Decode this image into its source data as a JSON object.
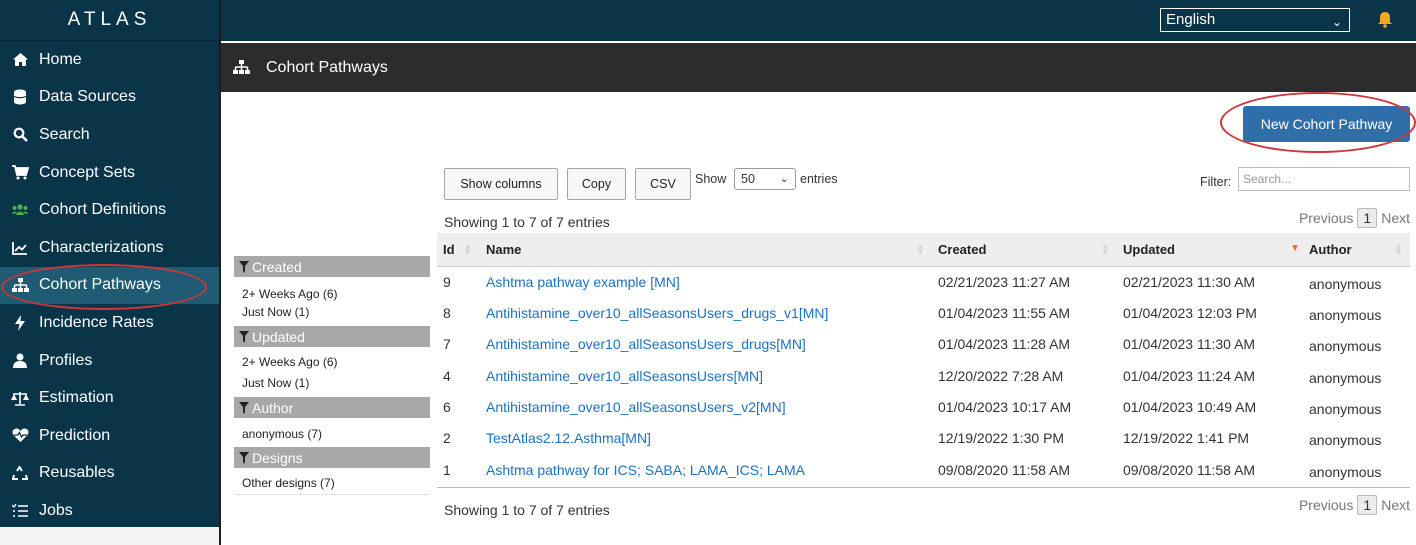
{
  "app": {
    "brand": "ATLAS",
    "language": "English"
  },
  "sidebar": {
    "items": [
      {
        "label": "Home",
        "icon": "home-icon"
      },
      {
        "label": "Data Sources",
        "icon": "database-icon"
      },
      {
        "label": "Search",
        "icon": "search-icon"
      },
      {
        "label": "Concept Sets",
        "icon": "cart-icon"
      },
      {
        "label": "Cohort Definitions",
        "icon": "users-icon"
      },
      {
        "label": "Characterizations",
        "icon": "chart-line-icon"
      },
      {
        "label": "Cohort Pathways",
        "icon": "sitemap-icon",
        "active": true
      },
      {
        "label": "Incidence Rates",
        "icon": "bolt-icon"
      },
      {
        "label": "Profiles",
        "icon": "user-icon"
      },
      {
        "label": "Estimation",
        "icon": "balance-scale-icon"
      },
      {
        "label": "Prediction",
        "icon": "heartbeat-icon"
      },
      {
        "label": "Reusables",
        "icon": "recycle-icon"
      },
      {
        "label": "Jobs",
        "icon": "list-icon"
      }
    ]
  },
  "page": {
    "title": "Cohort Pathways",
    "new_button": "New Cohort Pathway"
  },
  "toolbar": {
    "show_columns": "Show columns",
    "copy": "Copy",
    "csv": "CSV",
    "show_label": "Show",
    "entries_label": "entries",
    "page_length": "50",
    "filter_label": "Filter:",
    "filter_placeholder": "Search..."
  },
  "table": {
    "info": "Showing 1 to 7 of 7 entries",
    "pager": {
      "previous": "Previous",
      "current": "1",
      "next": "Next"
    },
    "columns": [
      "Id",
      "Name",
      "Created",
      "Updated",
      "Author"
    ],
    "sorted_column": "Updated",
    "rows": [
      {
        "id": "9",
        "name": "Ashtma pathway example [MN]",
        "created": "02/21/2023 11:27 AM",
        "updated": "02/21/2023 11:30 AM",
        "author": "anonymous"
      },
      {
        "id": "8",
        "name": "Antihistamine_over10_allSeasonsUsers_drugs_v1[MN]",
        "created": "01/04/2023 11:55 AM",
        "updated": "01/04/2023 12:03 PM",
        "author": "anonymous"
      },
      {
        "id": "7",
        "name": "Antihistamine_over10_allSeasonsUsers_drugs[MN]",
        "created": "01/04/2023 11:28 AM",
        "updated": "01/04/2023 11:30 AM",
        "author": "anonymous"
      },
      {
        "id": "4",
        "name": "Antihistamine_over10_allSeasonsUsers[MN]",
        "created": "12/20/2022 7:28 AM",
        "updated": "01/04/2023 11:24 AM",
        "author": "anonymous"
      },
      {
        "id": "6",
        "name": "Antihistamine_over10_allSeasonsUsers_v2[MN]",
        "created": "01/04/2023 10:17 AM",
        "updated": "01/04/2023 10:49 AM",
        "author": "anonymous"
      },
      {
        "id": "2",
        "name": "TestAtlas2.12.Asthma[MN]",
        "created": "12/19/2022 1:30 PM",
        "updated": "12/19/2022 1:41 PM",
        "author": "anonymous"
      },
      {
        "id": "1",
        "name": "Ashtma pathway for ICS; SABA; LAMA_ICS; LAMA",
        "created": "09/08/2020 11:58 AM",
        "updated": "09/08/2020 11:58 AM",
        "author": "anonymous"
      }
    ]
  },
  "facets": [
    {
      "title": "Created",
      "items": [
        "2+ Weeks Ago (6)",
        "Just Now (1)"
      ]
    },
    {
      "title": "Updated",
      "items": [
        "2+ Weeks Ago (6)",
        "Just Now (1)"
      ]
    },
    {
      "title": "Author",
      "items": [
        "anonymous (7)"
      ]
    },
    {
      "title": "Designs",
      "items": [
        "Other designs (7)"
      ]
    }
  ],
  "colors": {
    "sidebar": "#0a3549",
    "accent_button": "#2f6ea8",
    "link": "#1a72c4",
    "highlight_ring": "#d0353b",
    "bell": "#f5a623"
  }
}
